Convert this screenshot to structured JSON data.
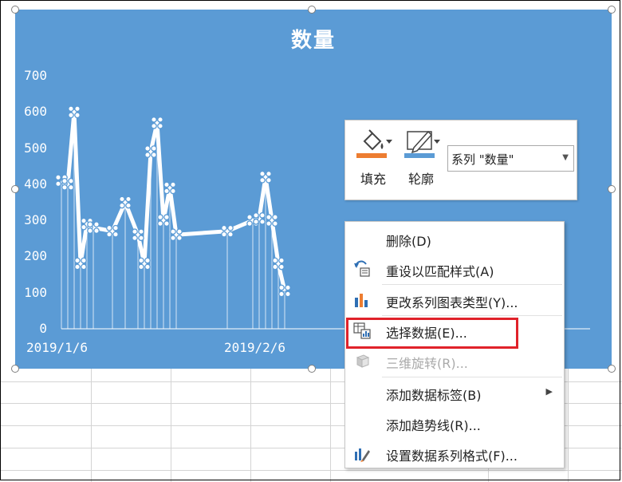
{
  "chart": {
    "title": "数量",
    "ylim": [
      0,
      700
    ],
    "y_ticks": [
      "700",
      "600",
      "500",
      "400",
      "300",
      "200",
      "100",
      "0"
    ],
    "x_ticks": [
      "2019/1/6",
      "2019/2/6"
    ]
  },
  "chart_data": {
    "type": "line",
    "title": "数量",
    "x_tick_labels": [
      "2019/1/6",
      "2019/2/6"
    ],
    "ylim": [
      0,
      700
    ],
    "series": [
      {
        "name": "数量",
        "x": [
          "2019/1/6",
          "2019/1/7",
          "2019/1/8",
          "2019/1/9",
          "2019/1/10",
          "2019/1/11",
          "2019/1/14",
          "2019/1/16",
          "2019/1/18",
          "2019/1/19",
          "2019/1/20",
          "2019/1/21",
          "2019/1/22",
          "2019/1/23",
          "2019/1/24",
          "2019/2/1",
          "2019/2/5",
          "2019/2/6",
          "2019/2/7",
          "2019/2/8",
          "2019/2/9",
          "2019/2/10"
        ],
        "values": [
          410,
          400,
          600,
          180,
          290,
          280,
          270,
          350,
          260,
          180,
          490,
          570,
          300,
          390,
          260,
          270,
          300,
          305,
          420,
          300,
          180,
          105
        ]
      }
    ]
  },
  "mini_toolbar": {
    "fill_label": "填充",
    "outline_label": "轮廓",
    "series_select_value": "系列 \"数量\""
  },
  "context_menu": {
    "items": [
      {
        "label": "删除(D)",
        "icon": "",
        "enabled": true
      },
      {
        "label": "重设以匹配样式(A)",
        "icon": "reset-style-icon",
        "enabled": true
      },
      {
        "label": "更改系列图表类型(Y)...",
        "icon": "chart-type-icon",
        "enabled": true
      },
      {
        "label": "选择数据(E)...",
        "icon": "select-data-icon",
        "enabled": true
      },
      {
        "label": "三维旋转(R)...",
        "icon": "rotate-3d-icon",
        "enabled": false
      },
      {
        "label": "添加数据标签(B)",
        "icon": "",
        "enabled": true,
        "has_submenu": true
      },
      {
        "label": "添加趋势线(R)...",
        "icon": "",
        "enabled": true
      },
      {
        "label": "设置数据系列格式(F)...",
        "icon": "format-series-icon",
        "enabled": true
      }
    ]
  },
  "colors": {
    "chart_background": "#5b9bd5",
    "line": "#ffffff",
    "highlight": "#e0222a",
    "fill_swatch": "#ed7d31",
    "outline_swatch": "#5b9bd5"
  }
}
